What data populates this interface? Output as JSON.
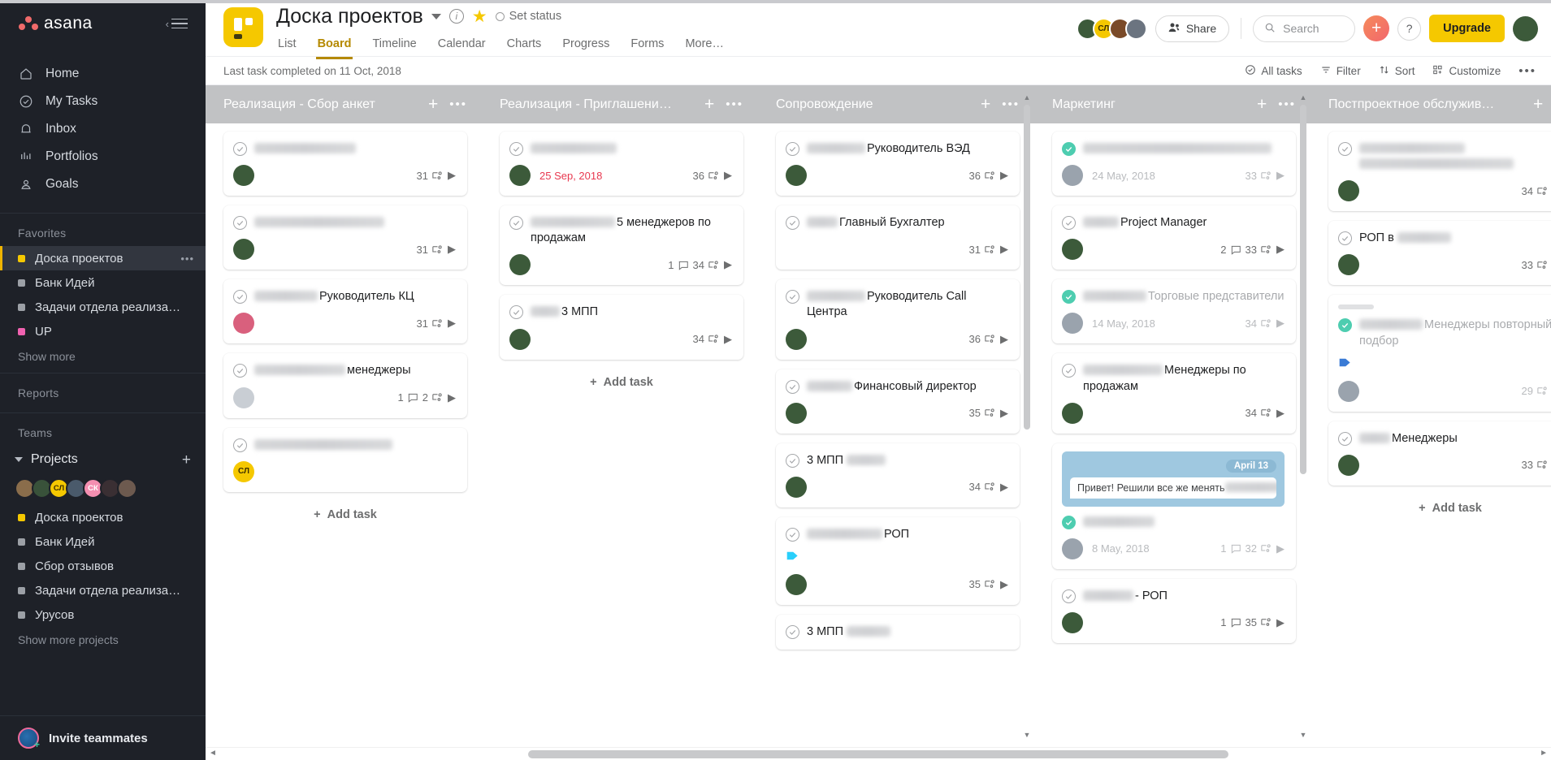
{
  "sidebar": {
    "brand": "asana",
    "nav": [
      {
        "label": "Home",
        "icon": "home-icon"
      },
      {
        "label": "My Tasks",
        "icon": "check-circle-icon"
      },
      {
        "label": "Inbox",
        "icon": "bell-icon"
      },
      {
        "label": "Portfolios",
        "icon": "bars-icon"
      },
      {
        "label": "Goals",
        "icon": "goal-person-icon"
      }
    ],
    "favorites_label": "Favorites",
    "favorites": [
      {
        "label": "Доска проектов",
        "color": "#f5c800",
        "active": true,
        "dots": "•••"
      },
      {
        "label": "Банк Идей",
        "color": "#9ca0a6",
        "active": false
      },
      {
        "label": "Задачи отдела реализа…",
        "color": "#9ca0a6",
        "active": false
      },
      {
        "label": "UP",
        "color": "#f062b0",
        "active": false
      }
    ],
    "show_more": "Show more",
    "reports_label": "Reports",
    "teams_label": "Teams",
    "team_name": "Projects",
    "team_avatars": [
      {
        "initials": "",
        "color": "#8a6d4b"
      },
      {
        "initials": "",
        "color": "#39523a"
      },
      {
        "initials": "СЛ",
        "color": "#f5c800"
      },
      {
        "initials": "",
        "color": "#4a5a6b"
      },
      {
        "initials": "СК",
        "color": "#f48fb1"
      },
      {
        "initials": "",
        "color": "#3a2f33"
      },
      {
        "initials": "",
        "color": "#6d5a4f"
      }
    ],
    "projects": [
      {
        "label": "Доска проектов",
        "color": "#f5c800"
      },
      {
        "label": "Банк Идей",
        "color": "#9ca0a6"
      },
      {
        "label": "Сбор отзывов",
        "color": "#9ca0a6"
      },
      {
        "label": "Задачи отдела реализа…",
        "color": "#9ca0a6"
      },
      {
        "label": "Урусов",
        "color": "#9ca0a6"
      }
    ],
    "show_more_projects": "Show more projects",
    "invite": "Invite teammates"
  },
  "header": {
    "project_title": "Доска проектов",
    "set_status": "Set status",
    "tabs": [
      {
        "label": "List",
        "active": false
      },
      {
        "label": "Board",
        "active": true
      },
      {
        "label": "Timeline",
        "active": false
      },
      {
        "label": "Calendar",
        "active": false
      },
      {
        "label": "Charts",
        "active": false
      },
      {
        "label": "Progress",
        "active": false
      },
      {
        "label": "Forms",
        "active": false
      },
      {
        "label": "More…",
        "active": false
      }
    ],
    "members": [
      {
        "initials": "",
        "color": "#3c5a3a"
      },
      {
        "initials": "СЛ",
        "color": "#f5c800"
      },
      {
        "initials": "",
        "color": "#7a4a28"
      },
      {
        "initials": "",
        "color": "#6b7480"
      }
    ],
    "share_label": "Share",
    "search_placeholder": "Search",
    "plus_label": "+",
    "help_label": "?",
    "upgrade_label": "Upgrade",
    "me_avatar": {
      "initials": "",
      "color": "#3c5a3a"
    }
  },
  "subbar": {
    "last_task": "Last task completed on 11 Oct, 2018",
    "all_tasks": "All tasks",
    "filter": "Filter",
    "sort": "Sort",
    "customize": "Customize",
    "more": "•••"
  },
  "board": {
    "add_task_label": "Add task",
    "columns": [
      {
        "title": "Реализация - Сбор анкет",
        "show_add_task": true,
        "scroll": null,
        "cards": [
          {
            "redacted_lead": 125,
            "title": "",
            "done": false,
            "avatar": {
              "color": "#3c5a3a"
            },
            "due": "",
            "comments": "",
            "subtasks": "31"
          },
          {
            "redacted_lead": 160,
            "title": "",
            "done": false,
            "avatar": {
              "color": "#3c5a3a"
            },
            "due": "",
            "comments": "",
            "subtasks": "31"
          },
          {
            "redacted_lead": 78,
            "title": "Руководитель КЦ",
            "done": false,
            "avatar": {
              "color": "#d9607d"
            },
            "due": "",
            "comments": "",
            "subtasks": "31"
          },
          {
            "redacted_lead": 112,
            "title": "менеджеры",
            "done": false,
            "avatar": {
              "color": "#c9ced4"
            },
            "due": "",
            "comments": "1",
            "subtasks": "2"
          },
          {
            "redacted_lead": 170,
            "title": "",
            "done": false,
            "avatar": {
              "color": "#f5c800",
              "initials": "СЛ"
            },
            "due": "",
            "comments": "",
            "subtasks": ""
          }
        ]
      },
      {
        "title": "Реализация - Приглашени…",
        "show_add_task": true,
        "scroll": null,
        "cards": [
          {
            "redacted_lead": 106,
            "title": "",
            "done": false,
            "avatar": {
              "color": "#3c5a3a"
            },
            "due": "25 Sep, 2018",
            "due_state": "overdue",
            "comments": "",
            "subtasks": "36"
          },
          {
            "redacted_lead": 104,
            "title": "5 менеджеров по продажам",
            "done": false,
            "avatar": {
              "color": "#3c5a3a"
            },
            "due": "",
            "comments": "1",
            "subtasks": "34"
          },
          {
            "redacted_lead": 36,
            "title": "3 МПП",
            "done": false,
            "avatar": {
              "color": "#3c5a3a"
            },
            "due": "",
            "comments": "",
            "subtasks": "34"
          }
        ]
      },
      {
        "title": "Сопровождение",
        "show_add_task": false,
        "scroll": {
          "top_pct": 0,
          "height_pct": 62
        },
        "cards": [
          {
            "redacted_lead": 72,
            "title": "Руководитель ВЭД",
            "done": false,
            "avatar": {
              "color": "#3c5a3a"
            },
            "due": "",
            "comments": "",
            "subtasks": "36"
          },
          {
            "redacted_lead": 38,
            "title": "Главный Бухгалтер",
            "done": false,
            "avatar": null,
            "due": "",
            "comments": "",
            "subtasks": "31"
          },
          {
            "redacted_lead": 72,
            "title": "Руководитель Call Центра",
            "done": false,
            "avatar": {
              "color": "#3c5a3a"
            },
            "due": "",
            "comments": "",
            "subtasks": "36"
          },
          {
            "redacted_lead": 56,
            "title": "Финансовый директор",
            "done": false,
            "avatar": {
              "color": "#3c5a3a"
            },
            "due": "",
            "comments": "",
            "subtasks": "35"
          },
          {
            "title_prefix": "3 МПП",
            "redacted_trail": 48,
            "done": false,
            "avatar": {
              "color": "#3c5a3a"
            },
            "due": "",
            "comments": "",
            "subtasks": "34"
          },
          {
            "redacted_lead": 93,
            "title": "РОП",
            "done": false,
            "tag": "#29cffb",
            "avatar": {
              "color": "#3c5a3a"
            },
            "due": "",
            "comments": "",
            "subtasks": "35"
          },
          {
            "title_prefix": "3 МПП",
            "redacted_trail": 54,
            "done": false,
            "avatar": null,
            "due": "",
            "comments": "",
            "subtasks": ""
          }
        ]
      },
      {
        "title": "Маркетинг",
        "show_add_task": false,
        "scroll": {
          "top_pct": 0,
          "height_pct": 70
        },
        "cards": [
          {
            "redacted_lead": 232,
            "title": "",
            "done": true,
            "muted": true,
            "avatar": {
              "color": "#6b7480"
            },
            "due": "24 May, 2018",
            "due_state": "muted",
            "comments": "",
            "subtasks": "33"
          },
          {
            "redacted_lead": 44,
            "title": "Project Manager",
            "done": false,
            "avatar": {
              "color": "#3c5a3a"
            },
            "due": "",
            "comments": "2",
            "subtasks": "33"
          },
          {
            "redacted_lead": 78,
            "title": "Торговые представители",
            "done": true,
            "muted": true,
            "avatar": {
              "color": "#6b7480"
            },
            "due": "14 May, 2018",
            "due_state": "muted",
            "comments": "",
            "subtasks": "34"
          },
          {
            "redacted_lead": 98,
            "title": "Менеджеры по продажам",
            "done": false,
            "avatar": {
              "color": "#3c5a3a"
            },
            "due": "",
            "comments": "",
            "subtasks": "34"
          },
          {
            "bubble": {
              "date": "April 13",
              "message": "Привет! Решили все же менять"
            },
            "redacted_lead": 88,
            "title": "",
            "done": true,
            "muted": true,
            "avatar": {
              "color": "#6b7480"
            },
            "due": "8 May, 2018",
            "due_state": "muted",
            "comments": "1",
            "subtasks": "32"
          },
          {
            "redacted_lead": 62,
            "title": "- РОП",
            "done": false,
            "avatar": {
              "color": "#3c5a3a"
            },
            "due": "",
            "comments": "1",
            "subtasks": "35"
          }
        ]
      },
      {
        "title": "Постпроектное обслужив…",
        "show_add_task": true,
        "scroll": null,
        "cards": [
          {
            "redacted_lead": 130,
            "redacted_second": 190,
            "title": "",
            "done": false,
            "avatar": {
              "color": "#3c5a3a"
            },
            "due": "",
            "comments": "",
            "subtasks": "34"
          },
          {
            "title_prefix": "РОП в",
            "redacted_trail": 66,
            "done": false,
            "avatar": {
              "color": "#3c5a3a"
            },
            "due": "",
            "comments": "",
            "subtasks": "33"
          },
          {
            "stub": true,
            "redacted_lead": 78,
            "title": "Менеджеры повторный подбор",
            "done": true,
            "muted": true,
            "tag": "#3a7bd5",
            "avatar": {
              "color": "#6b7480"
            },
            "due": "",
            "comments": "",
            "subtasks": "29"
          },
          {
            "redacted_lead": 38,
            "title": "Менеджеры",
            "done": false,
            "avatar": {
              "color": "#3c5a3a"
            },
            "due": "",
            "comments": "",
            "subtasks": "33"
          }
        ]
      }
    ]
  },
  "scrollbar": {
    "left_arrow": "◄",
    "right_arrow": "►",
    "thumb_left_pct": 24,
    "thumb_width_pct": 52
  },
  "colors": {
    "accent_yellow": "#f5c800",
    "sidebar_bg": "#1e2128",
    "column_header": "#c1c2c4",
    "overdue_red": "#e8384f",
    "done_green": "#4ecdb0"
  }
}
